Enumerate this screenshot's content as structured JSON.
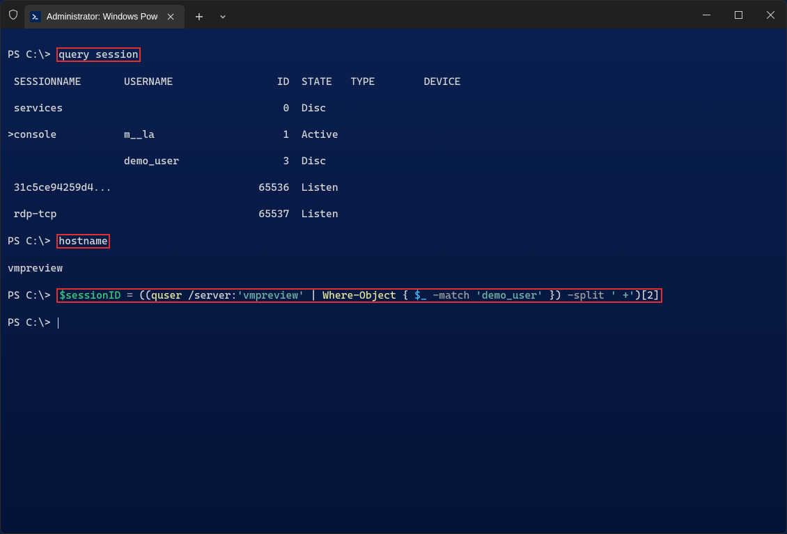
{
  "window": {
    "tab_title": "Administrator: Windows Powe",
    "minimize_tooltip": "Minimize",
    "maximize_tooltip": "Maximize",
    "close_tooltip": "Close"
  },
  "terminal": {
    "prompt": "PS C:\\>",
    "cmd1": "query session",
    "header": " SESSIONNAME       USERNAME                 ID  STATE   TYPE        DEVICE",
    "rows": [
      " services                                    0  Disc",
      ">console           m__la                     1  Active",
      "                   demo_user                 3  Disc",
      " 31c5ce94259d4...                        65536  Listen",
      " rdp-tcp                                 65537  Listen"
    ],
    "cmd2": "hostname",
    "hostname_out": "vmpreview",
    "cmd3_tokens": {
      "var": "$sessionID",
      "eq": " = ",
      "open": "((",
      "quser": "quser",
      "srvflag": " /server:",
      "srvstr": "'vmpreview'",
      "pipe": " | ",
      "where": "Where-Object",
      "space": " ",
      "lb": "{ ",
      "auto": "$_",
      "match": " -match ",
      "userstr": "'demo_user'",
      "rb": " }",
      "close1": ")",
      "split": " -split ",
      "splitstr": "' +'",
      "close2": ")",
      "idx": "[2]"
    }
  }
}
